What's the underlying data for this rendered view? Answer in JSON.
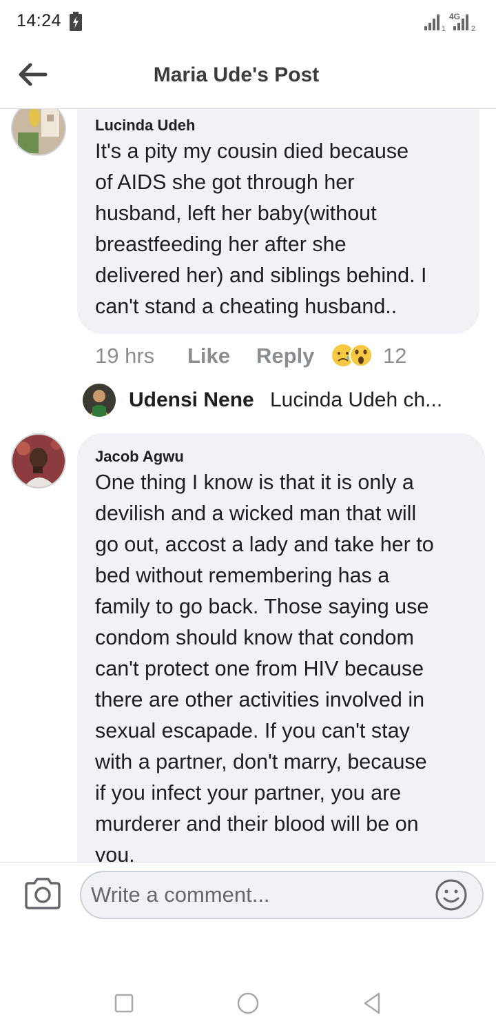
{
  "status_bar": {
    "time": "14:24",
    "network": "4G",
    "sim1": "1",
    "sim2": "2"
  },
  "header": {
    "title": "Maria Ude's Post"
  },
  "comments": [
    {
      "author": "Lucinda Udeh",
      "lines": [
        "It's a pity my cousin died because",
        "of AIDS she got through her",
        "husband, left her baby(without",
        "breastfeeding her after she",
        "delivered her) and siblings behind. I",
        "can't stand a cheating husband.."
      ],
      "time": "19 hrs",
      "like_label": "Like",
      "reply_label": "Reply",
      "reaction_icons": [
        "sad-reaction-icon",
        "wow-reaction-icon"
      ],
      "reaction_count": "12",
      "reply_preview": {
        "name": "Udensi Nene",
        "snippet": "Lucinda Udeh ch..."
      }
    },
    {
      "author": "Jacob Agwu",
      "lines": [
        "One thing I know is that it is only a",
        "devilish and a wicked man that will",
        "go out, accost a lady and take her to",
        "bed without remembering has a",
        "family to go back. Those saying use",
        "condom should know that condom",
        "can't protect one from HIV because",
        "there are other activities involved in",
        "sexual escapade. If you can't stay",
        "with a partner, don't marry, because",
        "if you infect your partner, you are",
        "murderer and their blood will be on",
        "you."
      ]
    }
  ],
  "composer": {
    "placeholder": "Write a comment..."
  },
  "colors": {
    "bubble": "#f0f2f5",
    "muted_text": "#8a8d91",
    "title_text": "#3a3b3c"
  }
}
